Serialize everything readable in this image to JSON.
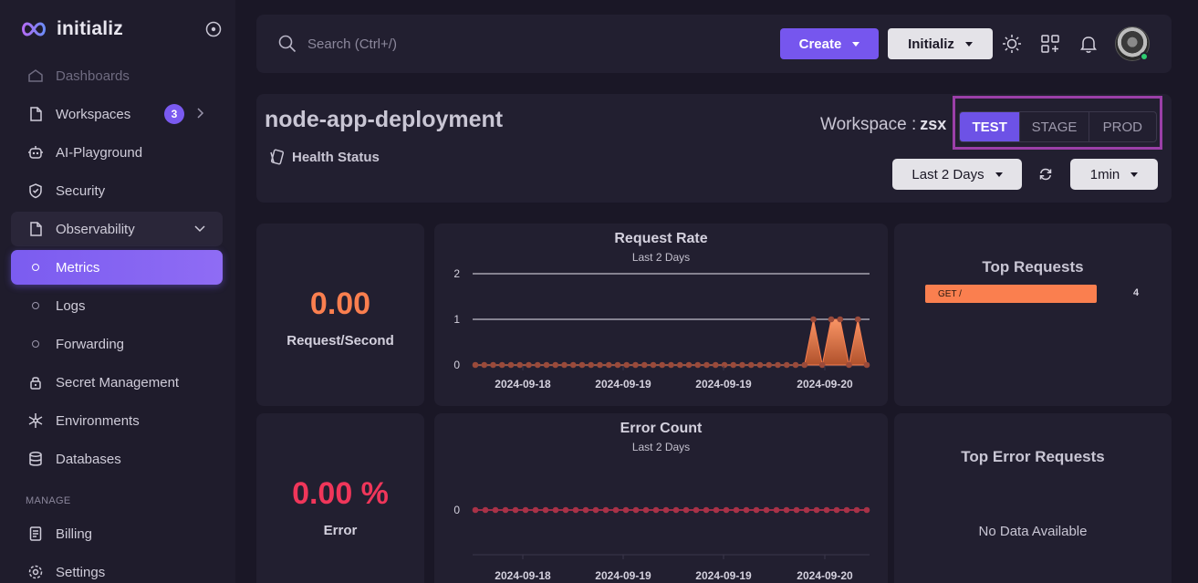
{
  "brand": {
    "name": "initializ"
  },
  "sidebar": {
    "items": [
      {
        "label": "Dashboards"
      },
      {
        "label": "Workspaces",
        "badge": "3"
      },
      {
        "label": "AI-Playground"
      },
      {
        "label": "Security"
      },
      {
        "label": "Observability"
      },
      {
        "label": "Metrics"
      },
      {
        "label": "Logs"
      },
      {
        "label": "Forwarding"
      },
      {
        "label": "Secret Management"
      },
      {
        "label": "Environments"
      },
      {
        "label": "Databases"
      }
    ],
    "section_manage": "MANAGE",
    "manage_items": [
      {
        "label": "Billing"
      },
      {
        "label": "Settings"
      }
    ]
  },
  "topbar": {
    "search_placeholder": "Search (Ctrl+/)",
    "create_label": "Create",
    "org_label": "Initializ"
  },
  "header": {
    "title": "node-app-deployment",
    "health_label": "Health Status",
    "workspace_label": "Workspace :",
    "workspace_value": "zsx",
    "envs": [
      "TEST",
      "STAGE",
      "PROD"
    ],
    "selected_env": "TEST",
    "range": "Last 2 Days",
    "interval": "1min"
  },
  "stats": {
    "request_rate_value": "0.00",
    "request_rate_label": "Request/Second",
    "error_value": "0.00 %",
    "error_label": "Error"
  },
  "top_requests": {
    "title": "Top Requests",
    "items": [
      {
        "label": "GET /",
        "count": "4"
      }
    ]
  },
  "top_error_requests": {
    "title": "Top Error Requests",
    "empty": "No Data Available"
  },
  "colors": {
    "accent": "#7656ee",
    "orange": "#fa7f4f",
    "error": "#f0365a",
    "highlight": "#9b3fa8"
  },
  "chart_data": [
    {
      "type": "area",
      "title": "Request Rate",
      "subtitle": "Last 2 Days",
      "xlabel": "",
      "ylabel": "",
      "ylim": [
        0,
        2
      ],
      "yticks": [
        "0",
        "1",
        "2"
      ],
      "xticks": [
        "2024-09-18",
        "2024-09-19",
        "2024-09-19",
        "2024-09-20"
      ],
      "series": [
        {
          "values": [
            0,
            0,
            0,
            0,
            0,
            0,
            0,
            0,
            0,
            0,
            0,
            0,
            0,
            0,
            0,
            0,
            0,
            0,
            0,
            0,
            0,
            0,
            0,
            0,
            0,
            0,
            0,
            0,
            0,
            0,
            0,
            0,
            0,
            0,
            0,
            0,
            0,
            0,
            1,
            0,
            1,
            1,
            0,
            1,
            0
          ]
        }
      ]
    },
    {
      "type": "line",
      "title": "Error Count",
      "subtitle": "Last 2 Days",
      "xlabel": "",
      "ylabel": "",
      "yticks": [
        "0"
      ],
      "xticks": [
        "2024-09-18",
        "2024-09-19",
        "2024-09-19",
        "2024-09-20"
      ],
      "series": [
        {
          "values": [
            0,
            0,
            0,
            0,
            0,
            0,
            0,
            0,
            0,
            0,
            0,
            0,
            0,
            0,
            0,
            0,
            0,
            0,
            0,
            0,
            0,
            0,
            0,
            0,
            0,
            0,
            0,
            0,
            0,
            0,
            0,
            0,
            0,
            0,
            0,
            0,
            0,
            0,
            0,
            0
          ]
        }
      ]
    }
  ]
}
